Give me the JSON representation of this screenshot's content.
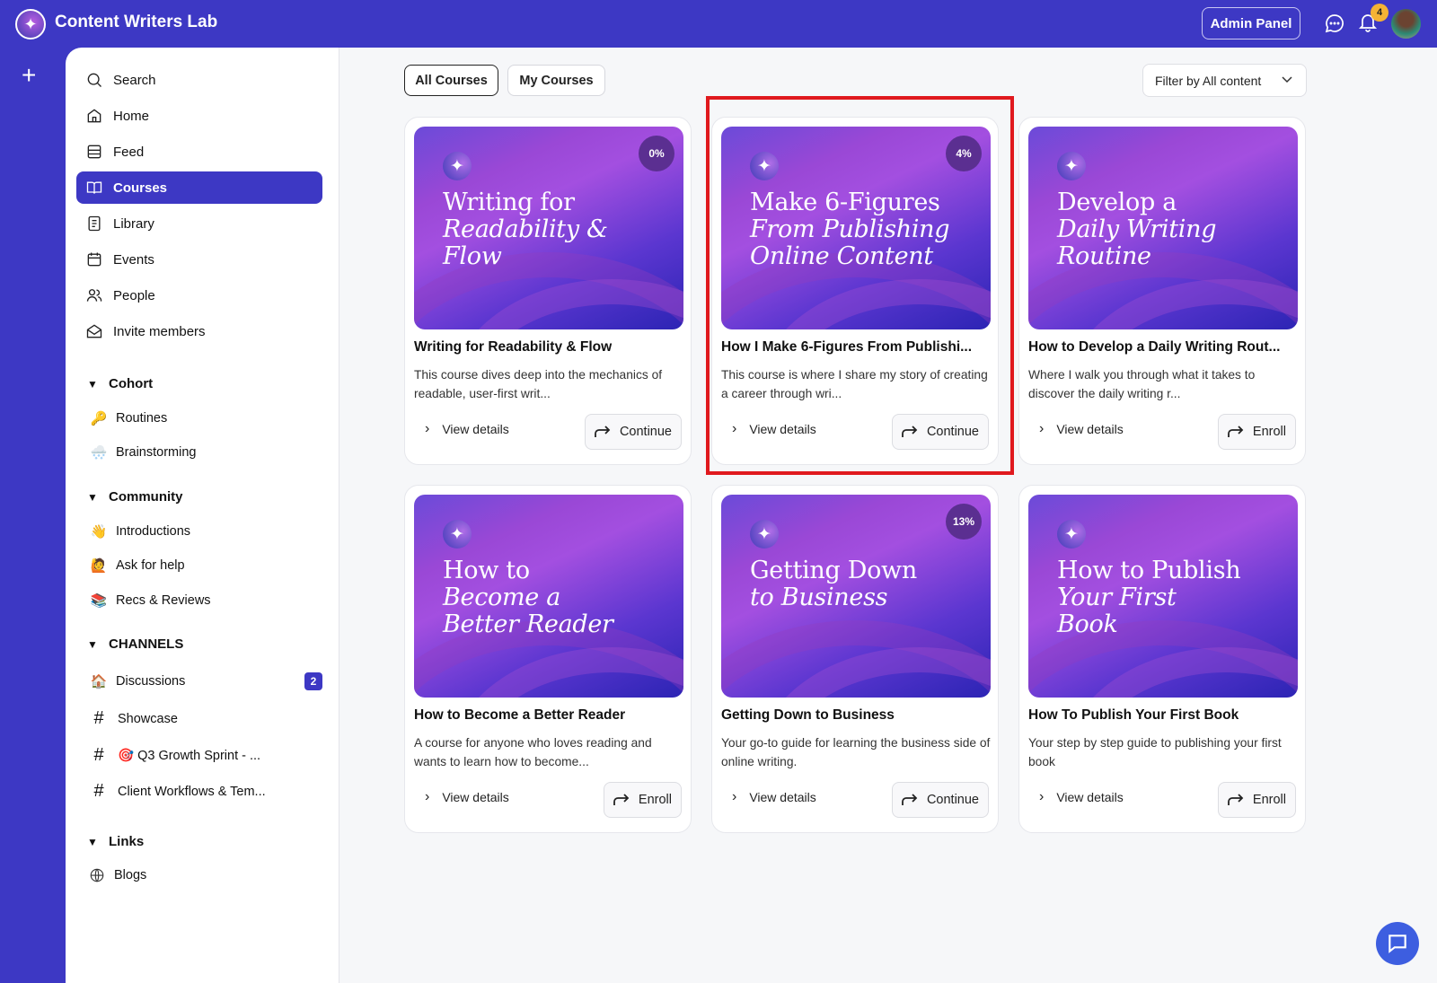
{
  "header": {
    "brand": "Content Writers Lab",
    "admin_button": "Admin Panel",
    "notification_count": "4"
  },
  "sidebar": {
    "nav": [
      {
        "label": "Search"
      },
      {
        "label": "Home"
      },
      {
        "label": "Feed"
      },
      {
        "label": "Courses"
      },
      {
        "label": "Library"
      },
      {
        "label": "Events"
      },
      {
        "label": "People"
      },
      {
        "label": "Invite members"
      }
    ],
    "cohort": {
      "title": "Cohort",
      "items": [
        {
          "emoji": "🔑",
          "label": "Routines"
        },
        {
          "emoji": "🌨️",
          "label": "Brainstorming"
        }
      ]
    },
    "community": {
      "title": "Community",
      "items": [
        {
          "emoji": "👋",
          "label": "Introductions"
        },
        {
          "emoji": "🙋",
          "label": "Ask for help"
        },
        {
          "emoji": "📚",
          "label": "Recs & Reviews"
        }
      ]
    },
    "channels": {
      "title": "CHANNELS",
      "items": [
        {
          "emoji": "🏠",
          "label": "Discussions",
          "badge": "2"
        },
        {
          "label": "Showcase"
        },
        {
          "label": "🎯 Q3 Growth Sprint - ..."
        },
        {
          "label": "Client Workflows & Tem..."
        }
      ]
    },
    "links": {
      "title": "Links",
      "items": [
        {
          "label": "Blogs"
        }
      ]
    }
  },
  "main": {
    "tabs": [
      {
        "label": "All Courses"
      },
      {
        "label": "My Courses"
      }
    ],
    "filter": "Filter by All content",
    "view_details": "View details",
    "courses": [
      {
        "cover_a": "Writing for",
        "cover_b": "Readability &",
        "cover_c": "Flow",
        "progress": "0%",
        "title": "Writing for Readability & Flow",
        "desc": "This course dives deep into the mechanics of readable, user-first writ...",
        "action": "Continue"
      },
      {
        "cover_a": "Make 6-Figures",
        "cover_b": "From Publishing",
        "cover_c": "Online Content",
        "progress": "4%",
        "title": "How I Make 6-Figures From Publishi...",
        "desc": "This course is where I share my story of creating a career through wri...",
        "action": "Continue"
      },
      {
        "cover_a": "Develop a",
        "cover_b": "Daily Writing",
        "cover_c": "Routine",
        "title": "How to Develop a Daily Writing Rout...",
        "desc": "Where I walk you through what it takes to discover the daily writing r...",
        "action": "Enroll"
      },
      {
        "cover_a": "How to",
        "cover_b": "Become a",
        "cover_c": "Better Reader",
        "title": "How to Become a Better Reader",
        "desc": "A course for anyone who loves reading and wants to learn how to become...",
        "action": "Enroll"
      },
      {
        "cover_a": "Getting Down",
        "cover_b": "to Business",
        "cover_c": "",
        "progress": "13%",
        "title": "Getting Down to Business",
        "desc": "Your go-to guide for learning the business side of online writing.",
        "action": "Continue"
      },
      {
        "cover_a": "How to Publish",
        "cover_b": "Your First",
        "cover_c": "Book",
        "title": "How To Publish Your First Book",
        "desc": "Your step by step guide to publishing your first book",
        "action": "Enroll"
      }
    ]
  }
}
